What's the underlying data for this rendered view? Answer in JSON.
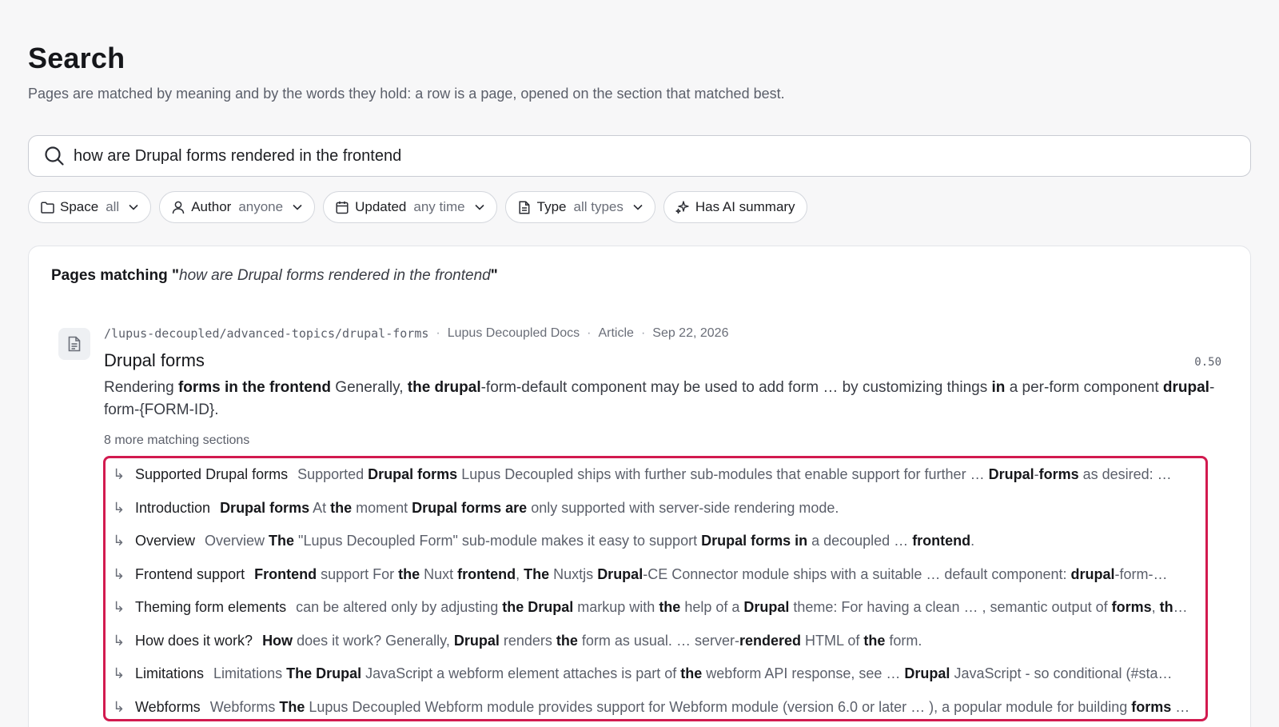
{
  "page": {
    "title": "Search",
    "subtitle": "Pages are matched by meaning and by the words they hold: a row is a page, opened on the section that matched best."
  },
  "search": {
    "query": "how are Drupal forms rendered in the frontend",
    "icon": "search-icon"
  },
  "filters": [
    {
      "label": "Space",
      "value": "all",
      "icon": "folder-icon"
    },
    {
      "label": "Author",
      "value": "anyone",
      "icon": "person-icon"
    },
    {
      "label": "Updated",
      "value": "any time",
      "icon": "calendar-icon"
    },
    {
      "label": "Type",
      "value": "all types",
      "icon": "document-icon"
    },
    {
      "label": "Has AI summary",
      "value": "",
      "icon": "sparkles-icon"
    }
  ],
  "results": {
    "heading_prefix": "Pages matching \"",
    "heading_query": "how are Drupal forms rendered in the frontend",
    "heading_suffix": "\"",
    "items": [
      {
        "path": "/lupus-decoupled/advanced-topics/drupal-forms",
        "space": "Lupus Decoupled Docs",
        "type": "Article",
        "date": "Sep 22, 2026",
        "title": "Drupal forms",
        "score": "0.50",
        "snippet_html": "Rendering <b>forms in the frontend</b> Generally, <b>the drupal</b>-form-default component may be used to add form … by customizing things <b>in</b> a per-form component <b>drupal</b>-form-{FORM-ID}.",
        "more_label": "8 more matching sections",
        "sections": [
          {
            "title": "Supported Drupal forms",
            "snippet_html": "Supported <b>Drupal forms</b> Lupus Decoupled ships with further sub-modules that enable support for further … <b>Drupal</b>-<b>forms</b> as desired: …"
          },
          {
            "title": "Introduction",
            "snippet_html": "<b>Drupal forms</b> At <b>the</b> moment <b>Drupal forms are</b> only supported with server-side rendering mode."
          },
          {
            "title": "Overview",
            "snippet_html": "Overview <b>The</b> \"Lupus Decoupled Form\" sub-module makes it easy to support <b>Drupal forms in</b> a decoupled … <b>frontend</b>."
          },
          {
            "title": "Frontend support",
            "snippet_html": "<b>Frontend</b> support For <b>the</b> Nuxt <b>frontend</b>, <b>The</b> Nuxtjs <b>Drupal</b>-CE Connector module ships with a suitable … default component: <b>drupal</b>-form-…"
          },
          {
            "title": "Theming form elements",
            "snippet_html": "can be altered only by adjusting <b>the Drupal</b> markup with <b>the</b> help of a <b>Drupal</b> theme: For having a clean … , semantic output of <b>forms</b>, <b>th</b>…"
          },
          {
            "title": "How does it work?",
            "snippet_html": "<b>How</b> does it work? Generally, <b>Drupal</b> renders <b>the</b> form as usual. … server-<b>rendered</b> HTML of <b>the</b> form."
          },
          {
            "title": "Limitations",
            "snippet_html": "Limitations <b>The Drupal</b> JavaScript a webform element attaches is part of <b>the</b> webform API response, see … <b>Drupal</b> JavaScript - so conditional (#sta…"
          },
          {
            "title": "Webforms",
            "snippet_html": "Webforms <b>The</b> Lupus Decoupled Webform module provides support for Webform module (version 6.0 or later … ), a popular module for building <b>forms</b> …"
          }
        ]
      }
    ]
  },
  "colors": {
    "highlight_border": "#d21a4f",
    "background": "#f7f7f8"
  }
}
